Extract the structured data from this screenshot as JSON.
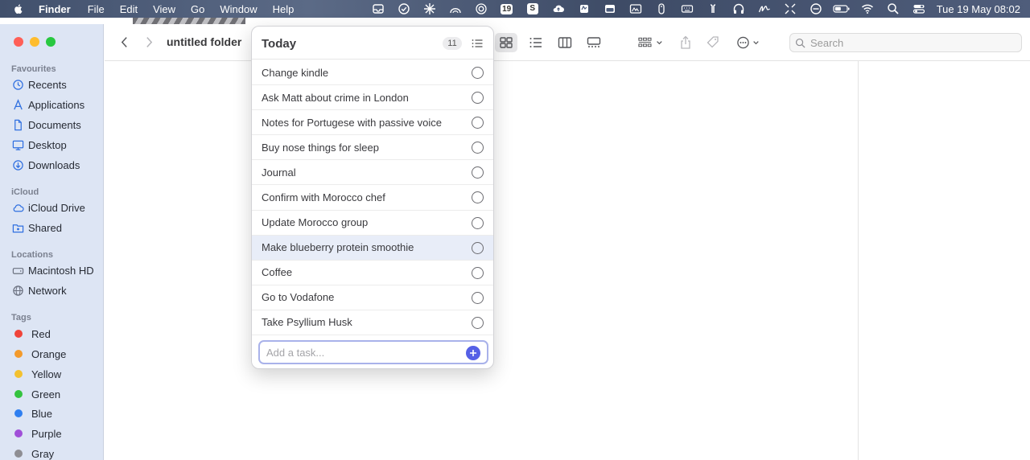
{
  "menubar": {
    "app_name": "Finder",
    "menus": [
      "File",
      "Edit",
      "View",
      "Go",
      "Window",
      "Help"
    ],
    "tray_badge_19": "19",
    "tray_badge_s": "S",
    "clock": "Tue 19 May  08:02"
  },
  "sidebar": {
    "favourites_label": "Favourites",
    "favourites": [
      {
        "label": "Recents",
        "icon": "clock-icon"
      },
      {
        "label": "Applications",
        "icon": "applications-icon"
      },
      {
        "label": "Documents",
        "icon": "document-icon"
      },
      {
        "label": "Desktop",
        "icon": "desktop-icon"
      },
      {
        "label": "Downloads",
        "icon": "download-icon"
      }
    ],
    "icloud_label": "iCloud",
    "icloud": [
      {
        "label": "iCloud Drive",
        "icon": "cloud-icon"
      },
      {
        "label": "Shared",
        "icon": "shared-folder-icon"
      }
    ],
    "locations_label": "Locations",
    "locations": [
      {
        "label": "Macintosh HD",
        "icon": "disk-icon"
      },
      {
        "label": "Network",
        "icon": "globe-icon"
      }
    ],
    "tags_label": "Tags",
    "tags": [
      {
        "label": "Red",
        "color": "#f0443a"
      },
      {
        "label": "Orange",
        "color": "#f39a2b"
      },
      {
        "label": "Yellow",
        "color": "#f3c12f"
      },
      {
        "label": "Green",
        "color": "#34c33f"
      },
      {
        "label": "Blue",
        "color": "#2f7ff0"
      },
      {
        "label": "Purple",
        "color": "#a04fd8"
      },
      {
        "label": "Gray",
        "color": "#8e8e93"
      }
    ]
  },
  "toolbar": {
    "folder_title": "untitled folder",
    "search_placeholder": "Search"
  },
  "popover": {
    "title": "Today",
    "count": "11",
    "tasks": [
      "Change kindle",
      "Ask Matt about crime in London",
      "Notes for Portugese with passive voice",
      "Buy nose things for sleep",
      "Journal",
      "Confirm with Morocco chef",
      "Update Morocco group",
      "Make blueberry protein smoothie",
      "Coffee",
      "Go to Vodafone",
      "Take Psyllium Husk"
    ],
    "add_placeholder": "Add a task...",
    "accent_color": "#5560e6"
  }
}
